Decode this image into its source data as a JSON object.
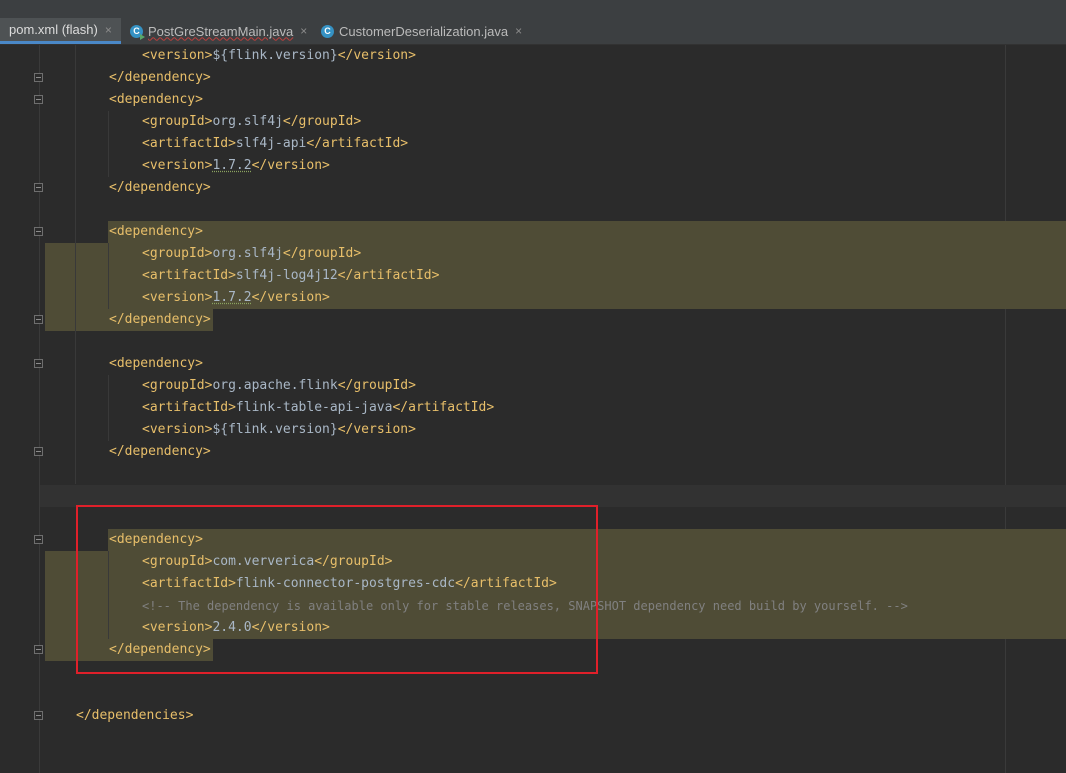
{
  "tabs": [
    {
      "label": "pom.xml (flash)",
      "icon": "maven-icon",
      "active": true
    },
    {
      "label": "PostGreStreamMain.java",
      "icon": "java-class-run-icon",
      "active": false
    },
    {
      "label": "CustomerDeserialization.java",
      "icon": "java-class-icon",
      "active": false
    }
  ],
  "tab_close_glyph": "×",
  "class_icon_letter": "C",
  "colors": {
    "xml_tag": "#e8bf6a",
    "text": "#a9b7c6",
    "comment": "#808080",
    "highlight": "#4f4c36",
    "annotation_box": "#e0202a",
    "editor_bg": "#2b2b2b"
  },
  "code": {
    "l1": {
      "open": "<version>",
      "val": "${flink.version}",
      "close": "</version>"
    },
    "l2": {
      "tag": "</dependency>"
    },
    "l3": {
      "tag": "<dependency>"
    },
    "l4": {
      "open": "<groupId>",
      "val": "org.slf4j",
      "close": "</groupId>"
    },
    "l5": {
      "open": "<artifactId>",
      "val": "slf4j-api",
      "close": "</artifactId>"
    },
    "l6": {
      "open": "<version>",
      "val": "1.7.2",
      "close": "</version>"
    },
    "l7": {
      "tag": "</dependency>"
    },
    "l9": {
      "tag": "<dependency>"
    },
    "l10": {
      "open": "<groupId>",
      "val": "org.slf4j",
      "close": "</groupId>"
    },
    "l11": {
      "open": "<artifactId>",
      "val": "slf4j-log4j12",
      "close": "</artifactId>"
    },
    "l12": {
      "open": "<version>",
      "val": "1.7.2",
      "close": "</version>"
    },
    "l13": {
      "tag": "</dependency>"
    },
    "l15": {
      "tag": "<dependency>"
    },
    "l16": {
      "open": "<groupId>",
      "val": "org.apache.flink",
      "close": "</groupId>"
    },
    "l17": {
      "open": "<artifactId>",
      "val": "flink-table-api-java",
      "close": "</artifactId>"
    },
    "l18": {
      "open": "<version>",
      "val": "${flink.version}",
      "close": "</version>"
    },
    "l19": {
      "tag": "</dependency>"
    },
    "l23": {
      "tag": "<dependency>"
    },
    "l24": {
      "open": "<groupId>",
      "val": "com.ververica",
      "close": "</groupId>"
    },
    "l25": {
      "open": "<artifactId>",
      "val": "flink-connector-postgres-cdc",
      "close": "</artifactId>"
    },
    "l26": {
      "comment": "<!-- The dependency is available only for stable releases, SNAPSHOT dependency need build by yourself. -->"
    },
    "l27": {
      "open": "<version>",
      "val": "2.4.0",
      "close": "</version>"
    },
    "l28": {
      "tag": "</dependency>"
    },
    "l31": {
      "tag": "</dependencies>"
    }
  }
}
